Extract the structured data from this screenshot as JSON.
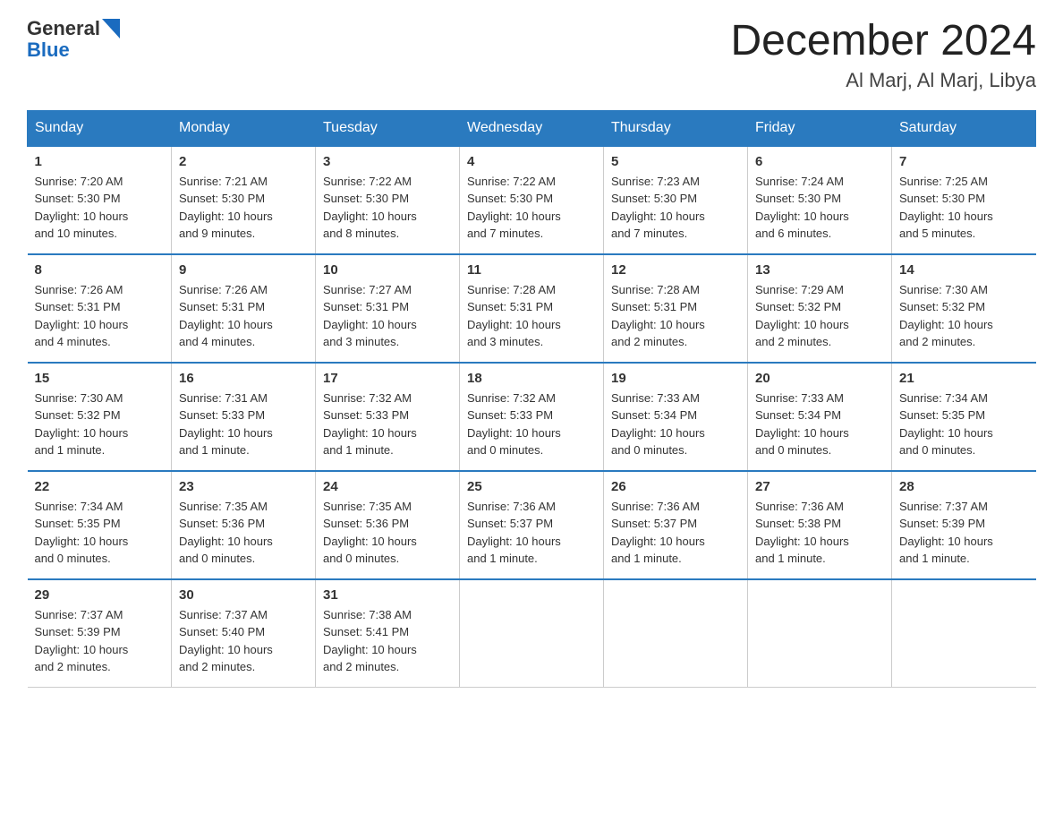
{
  "header": {
    "logo_general": "General",
    "logo_blue": "Blue",
    "title": "December 2024",
    "location": "Al Marj, Al Marj, Libya"
  },
  "days_of_week": [
    "Sunday",
    "Monday",
    "Tuesday",
    "Wednesday",
    "Thursday",
    "Friday",
    "Saturday"
  ],
  "weeks": [
    [
      {
        "day": "1",
        "sunrise": "7:20 AM",
        "sunset": "5:30 PM",
        "daylight": "10 hours and 10 minutes."
      },
      {
        "day": "2",
        "sunrise": "7:21 AM",
        "sunset": "5:30 PM",
        "daylight": "10 hours and 9 minutes."
      },
      {
        "day": "3",
        "sunrise": "7:22 AM",
        "sunset": "5:30 PM",
        "daylight": "10 hours and 8 minutes."
      },
      {
        "day": "4",
        "sunrise": "7:22 AM",
        "sunset": "5:30 PM",
        "daylight": "10 hours and 7 minutes."
      },
      {
        "day": "5",
        "sunrise": "7:23 AM",
        "sunset": "5:30 PM",
        "daylight": "10 hours and 7 minutes."
      },
      {
        "day": "6",
        "sunrise": "7:24 AM",
        "sunset": "5:30 PM",
        "daylight": "10 hours and 6 minutes."
      },
      {
        "day": "7",
        "sunrise": "7:25 AM",
        "sunset": "5:30 PM",
        "daylight": "10 hours and 5 minutes."
      }
    ],
    [
      {
        "day": "8",
        "sunrise": "7:26 AM",
        "sunset": "5:31 PM",
        "daylight": "10 hours and 4 minutes."
      },
      {
        "day": "9",
        "sunrise": "7:26 AM",
        "sunset": "5:31 PM",
        "daylight": "10 hours and 4 minutes."
      },
      {
        "day": "10",
        "sunrise": "7:27 AM",
        "sunset": "5:31 PM",
        "daylight": "10 hours and 3 minutes."
      },
      {
        "day": "11",
        "sunrise": "7:28 AM",
        "sunset": "5:31 PM",
        "daylight": "10 hours and 3 minutes."
      },
      {
        "day": "12",
        "sunrise": "7:28 AM",
        "sunset": "5:31 PM",
        "daylight": "10 hours and 2 minutes."
      },
      {
        "day": "13",
        "sunrise": "7:29 AM",
        "sunset": "5:32 PM",
        "daylight": "10 hours and 2 minutes."
      },
      {
        "day": "14",
        "sunrise": "7:30 AM",
        "sunset": "5:32 PM",
        "daylight": "10 hours and 2 minutes."
      }
    ],
    [
      {
        "day": "15",
        "sunrise": "7:30 AM",
        "sunset": "5:32 PM",
        "daylight": "10 hours and 1 minute."
      },
      {
        "day": "16",
        "sunrise": "7:31 AM",
        "sunset": "5:33 PM",
        "daylight": "10 hours and 1 minute."
      },
      {
        "day": "17",
        "sunrise": "7:32 AM",
        "sunset": "5:33 PM",
        "daylight": "10 hours and 1 minute."
      },
      {
        "day": "18",
        "sunrise": "7:32 AM",
        "sunset": "5:33 PM",
        "daylight": "10 hours and 0 minutes."
      },
      {
        "day": "19",
        "sunrise": "7:33 AM",
        "sunset": "5:34 PM",
        "daylight": "10 hours and 0 minutes."
      },
      {
        "day": "20",
        "sunrise": "7:33 AM",
        "sunset": "5:34 PM",
        "daylight": "10 hours and 0 minutes."
      },
      {
        "day": "21",
        "sunrise": "7:34 AM",
        "sunset": "5:35 PM",
        "daylight": "10 hours and 0 minutes."
      }
    ],
    [
      {
        "day": "22",
        "sunrise": "7:34 AM",
        "sunset": "5:35 PM",
        "daylight": "10 hours and 0 minutes."
      },
      {
        "day": "23",
        "sunrise": "7:35 AM",
        "sunset": "5:36 PM",
        "daylight": "10 hours and 0 minutes."
      },
      {
        "day": "24",
        "sunrise": "7:35 AM",
        "sunset": "5:36 PM",
        "daylight": "10 hours and 0 minutes."
      },
      {
        "day": "25",
        "sunrise": "7:36 AM",
        "sunset": "5:37 PM",
        "daylight": "10 hours and 1 minute."
      },
      {
        "day": "26",
        "sunrise": "7:36 AM",
        "sunset": "5:37 PM",
        "daylight": "10 hours and 1 minute."
      },
      {
        "day": "27",
        "sunrise": "7:36 AM",
        "sunset": "5:38 PM",
        "daylight": "10 hours and 1 minute."
      },
      {
        "day": "28",
        "sunrise": "7:37 AM",
        "sunset": "5:39 PM",
        "daylight": "10 hours and 1 minute."
      }
    ],
    [
      {
        "day": "29",
        "sunrise": "7:37 AM",
        "sunset": "5:39 PM",
        "daylight": "10 hours and 2 minutes."
      },
      {
        "day": "30",
        "sunrise": "7:37 AM",
        "sunset": "5:40 PM",
        "daylight": "10 hours and 2 minutes."
      },
      {
        "day": "31",
        "sunrise": "7:38 AM",
        "sunset": "5:41 PM",
        "daylight": "10 hours and 2 minutes."
      },
      {
        "day": "",
        "sunrise": "",
        "sunset": "",
        "daylight": ""
      },
      {
        "day": "",
        "sunrise": "",
        "sunset": "",
        "daylight": ""
      },
      {
        "day": "",
        "sunrise": "",
        "sunset": "",
        "daylight": ""
      },
      {
        "day": "",
        "sunrise": "",
        "sunset": "",
        "daylight": ""
      }
    ]
  ],
  "labels": {
    "sunrise": "Sunrise:",
    "sunset": "Sunset:",
    "daylight": "Daylight:"
  }
}
